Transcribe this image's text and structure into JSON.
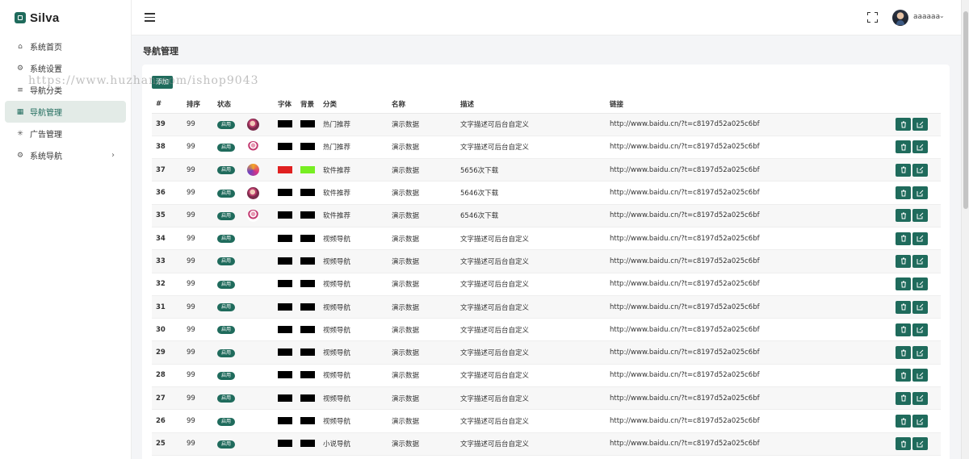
{
  "brand": {
    "name": "Silva"
  },
  "sidebar": {
    "items": [
      {
        "label": "系统首页",
        "icon": "home-icon",
        "glyph": "⌂"
      },
      {
        "label": "系统设置",
        "icon": "gear-icon",
        "glyph": "⚙"
      },
      {
        "label": "导航分类",
        "icon": "list-icon",
        "glyph": "≡"
      },
      {
        "label": "导航管理",
        "icon": "grid-icon",
        "glyph": "▦",
        "active": true
      },
      {
        "label": "广告管理",
        "icon": "loader-icon",
        "glyph": "✳"
      },
      {
        "label": "系统导航",
        "icon": "cog-icon",
        "glyph": "⚙",
        "has_arrow": true
      }
    ]
  },
  "header": {
    "username": "aaaaaa",
    "caret": "⌄"
  },
  "page": {
    "title": "导航管理",
    "add_label": "添加",
    "watermark": "https://www.huzhan.com/ishop9043"
  },
  "table": {
    "columns": [
      "#",
      "排序",
      "状态",
      "",
      "字体",
      "背景",
      "分类",
      "名称",
      "描述",
      "链接",
      ""
    ],
    "status_label": "启用",
    "rows": [
      {
        "id": "39",
        "sort": "99",
        "thumb": "girl",
        "font": "#000000",
        "bg": "#000000",
        "category": "热门推荐",
        "name": "演示数据",
        "desc": "文字描述可后台自定义",
        "link": "http://www.baidu.cn/?t=c8197d52a025c6bf"
      },
      {
        "id": "38",
        "sort": "99",
        "thumb": "dancer",
        "font": "#000000",
        "bg": "#000000",
        "category": "热门推荐",
        "name": "演示数据",
        "desc": "文字描述可后台自定义",
        "link": "http://www.baidu.cn/?t=c8197d52a025c6bf"
      },
      {
        "id": "37",
        "sort": "99",
        "thumb": "colorful",
        "font": "#e02020",
        "bg": "#77ee22",
        "category": "软件推荐",
        "name": "演示数据",
        "desc": "5656次下载",
        "link": "http://www.baidu.cn/?t=c8197d52a025c6bf"
      },
      {
        "id": "36",
        "sort": "99",
        "thumb": "girl",
        "font": "#000000",
        "bg": "#000000",
        "category": "软件推荐",
        "name": "演示数据",
        "desc": "5646次下载",
        "link": "http://www.baidu.cn/?t=c8197d52a025c6bf"
      },
      {
        "id": "35",
        "sort": "99",
        "thumb": "dancer",
        "font": "#000000",
        "bg": "#000000",
        "category": "软件推荐",
        "name": "演示数据",
        "desc": "6546次下载",
        "link": "http://www.baidu.cn/?t=c8197d52a025c6bf"
      },
      {
        "id": "34",
        "sort": "99",
        "thumb": "",
        "font": "#000000",
        "bg": "#000000",
        "category": "视频导航",
        "name": "演示数据",
        "desc": "文字描述可后台自定义",
        "link": "http://www.baidu.cn/?t=c8197d52a025c6bf"
      },
      {
        "id": "33",
        "sort": "99",
        "thumb": "",
        "font": "#000000",
        "bg": "#000000",
        "category": "视频导航",
        "name": "演示数据",
        "desc": "文字描述可后台自定义",
        "link": "http://www.baidu.cn/?t=c8197d52a025c6bf"
      },
      {
        "id": "32",
        "sort": "99",
        "thumb": "",
        "font": "#000000",
        "bg": "#000000",
        "category": "视频导航",
        "name": "演示数据",
        "desc": "文字描述可后台自定义",
        "link": "http://www.baidu.cn/?t=c8197d52a025c6bf"
      },
      {
        "id": "31",
        "sort": "99",
        "thumb": "",
        "font": "#000000",
        "bg": "#000000",
        "category": "视频导航",
        "name": "演示数据",
        "desc": "文字描述可后台自定义",
        "link": "http://www.baidu.cn/?t=c8197d52a025c6bf"
      },
      {
        "id": "30",
        "sort": "99",
        "thumb": "",
        "font": "#000000",
        "bg": "#000000",
        "category": "视频导航",
        "name": "演示数据",
        "desc": "文字描述可后台自定义",
        "link": "http://www.baidu.cn/?t=c8197d52a025c6bf"
      },
      {
        "id": "29",
        "sort": "99",
        "thumb": "",
        "font": "#000000",
        "bg": "#000000",
        "category": "视频导航",
        "name": "演示数据",
        "desc": "文字描述可后台自定义",
        "link": "http://www.baidu.cn/?t=c8197d52a025c6bf"
      },
      {
        "id": "28",
        "sort": "99",
        "thumb": "",
        "font": "#000000",
        "bg": "#000000",
        "category": "视频导航",
        "name": "演示数据",
        "desc": "文字描述可后台自定义",
        "link": "http://www.baidu.cn/?t=c8197d52a025c6bf"
      },
      {
        "id": "27",
        "sort": "99",
        "thumb": "",
        "font": "#000000",
        "bg": "#000000",
        "category": "视频导航",
        "name": "演示数据",
        "desc": "文字描述可后台自定义",
        "link": "http://www.baidu.cn/?t=c8197d52a025c6bf"
      },
      {
        "id": "26",
        "sort": "99",
        "thumb": "",
        "font": "#000000",
        "bg": "#000000",
        "category": "视频导航",
        "name": "演示数据",
        "desc": "文字描述可后台自定义",
        "link": "http://www.baidu.cn/?t=c8197d52a025c6bf"
      },
      {
        "id": "25",
        "sort": "99",
        "thumb": "",
        "font": "#000000",
        "bg": "#000000",
        "category": "小说导航",
        "name": "演示数据",
        "desc": "文字描述可后台自定义",
        "link": "http://www.baidu.cn/?t=c8197d52a025c6bf"
      }
    ]
  },
  "actions": {
    "delete_icon": "trash-icon",
    "edit_icon": "edit-icon"
  },
  "colors": {
    "accent": "#1f6b5c",
    "active_bg": "#e3ebe7"
  }
}
